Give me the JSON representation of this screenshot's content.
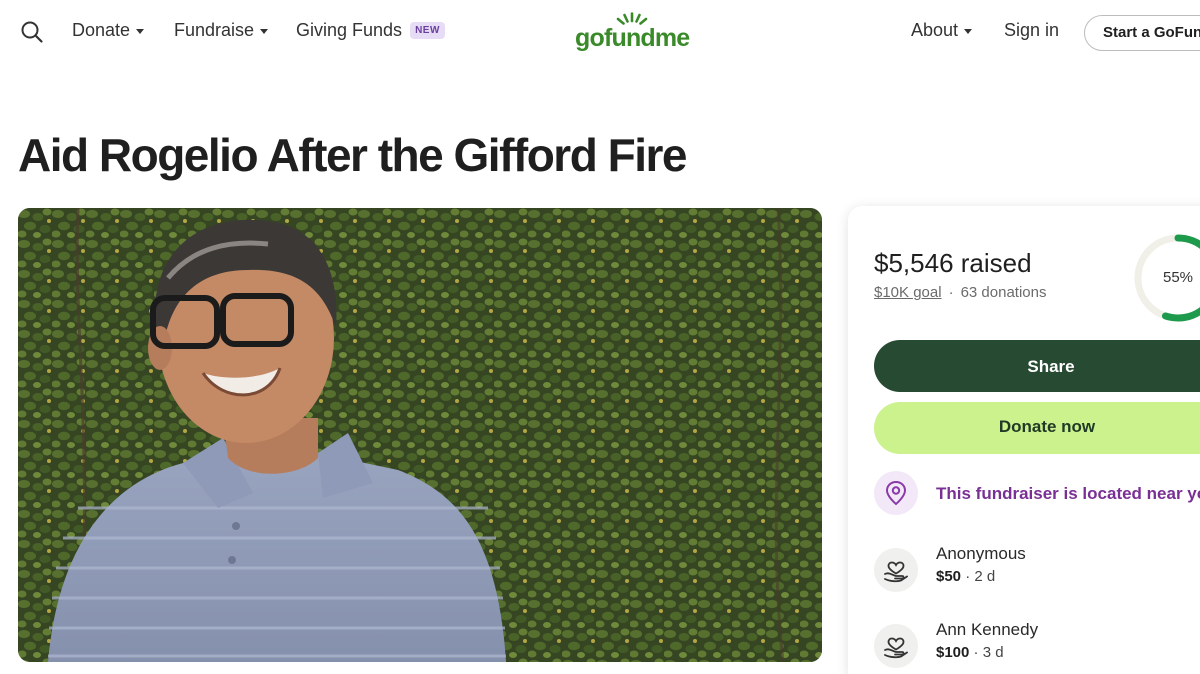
{
  "header": {
    "nav": [
      {
        "label": "Donate"
      },
      {
        "label": "Fundraise"
      },
      {
        "label": "Giving Funds",
        "badge": "NEW"
      }
    ],
    "logo_text": "gofundme",
    "about_label": "About",
    "signin_label": "Sign in",
    "start_label": "Start a GoFundMe"
  },
  "campaign": {
    "title": "Aid Rogelio After the Gifford Fire",
    "raised_amount": "$5,546",
    "raised_suffix": "raised",
    "goal": "$10K goal",
    "donations": "63 donations",
    "progress_label": "55%",
    "progress_fraction": 0.55
  },
  "actions": {
    "share_label": "Share",
    "donate_label": "Donate now"
  },
  "location_note": "This fundraiser is located near you",
  "donations_list": [
    {
      "name": "Anonymous",
      "amount": "$50",
      "age": "2 d"
    },
    {
      "name": "Ann Kennedy",
      "amount": "$100",
      "age": "3 d"
    }
  ],
  "colors": {
    "brand_green": "#3a8a2a",
    "share_bg": "#274a32",
    "donate_bg": "#cbf28c",
    "progress_green": "#1e9a4c",
    "location_purple": "#7a2f95"
  },
  "icons": {
    "search": "search-icon",
    "location": "map-pin-icon",
    "donation": "heart-hand-icon"
  }
}
